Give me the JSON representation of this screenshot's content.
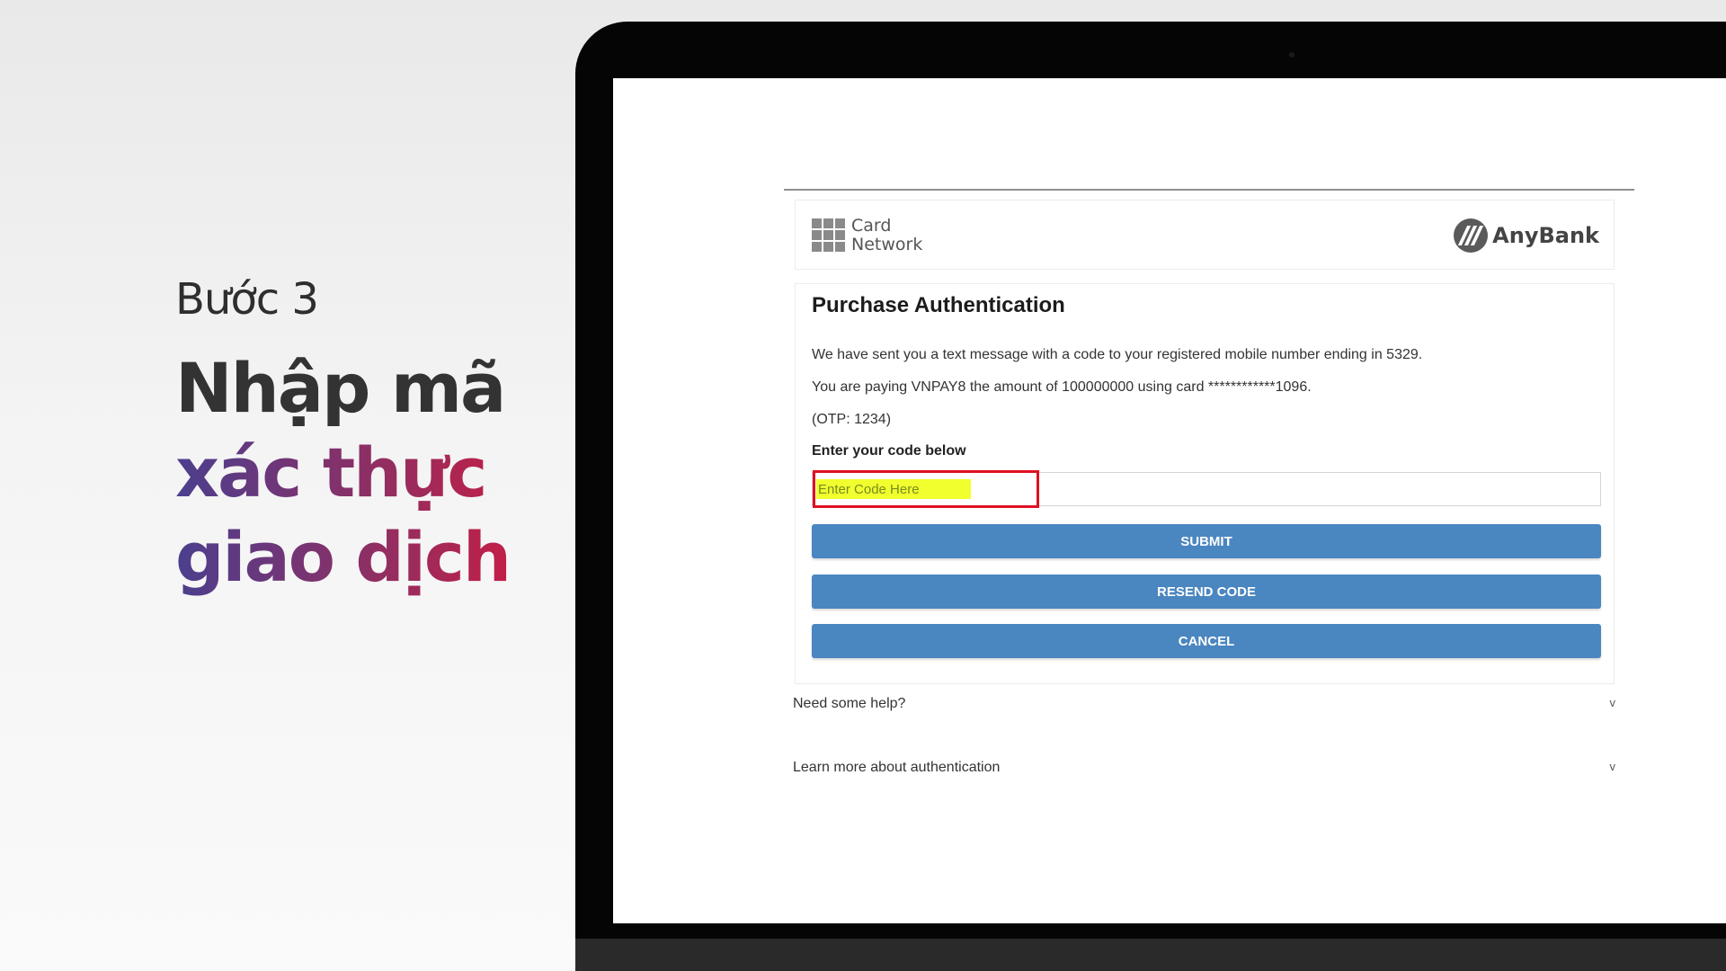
{
  "caption": {
    "step": "Bước 3",
    "line1": "Nhập mã",
    "line2": "xác thực",
    "line3": "giao dịch"
  },
  "brand": {
    "network_line1": "Card",
    "network_line2": "Network",
    "bank_name": "AnyBank"
  },
  "auth": {
    "title": "Purchase Authentication",
    "message": "We have sent you a text message with a code to your registered mobile number ending in 5329.",
    "payment_info": "You are paying VNPAY8 the amount of 100000000 using card ************1096.",
    "otp_hint": "(OTP: 1234)",
    "code_label": "Enter your code below",
    "code_placeholder": "Enter Code Here",
    "code_value": "",
    "submit_label": "SUBMIT",
    "resend_label": "RESEND CODE",
    "cancel_label": "CANCEL"
  },
  "help": {
    "need_help": "Need some help?",
    "learn_more": "Learn more about authentication",
    "chevron": "v"
  },
  "colors": {
    "button": "#4a86c0",
    "highlight": "#f1ff2e",
    "focus_box": "#e01020",
    "caption_gradient_start": "#4b3f8e",
    "caption_gradient_end": "#c21e47"
  }
}
